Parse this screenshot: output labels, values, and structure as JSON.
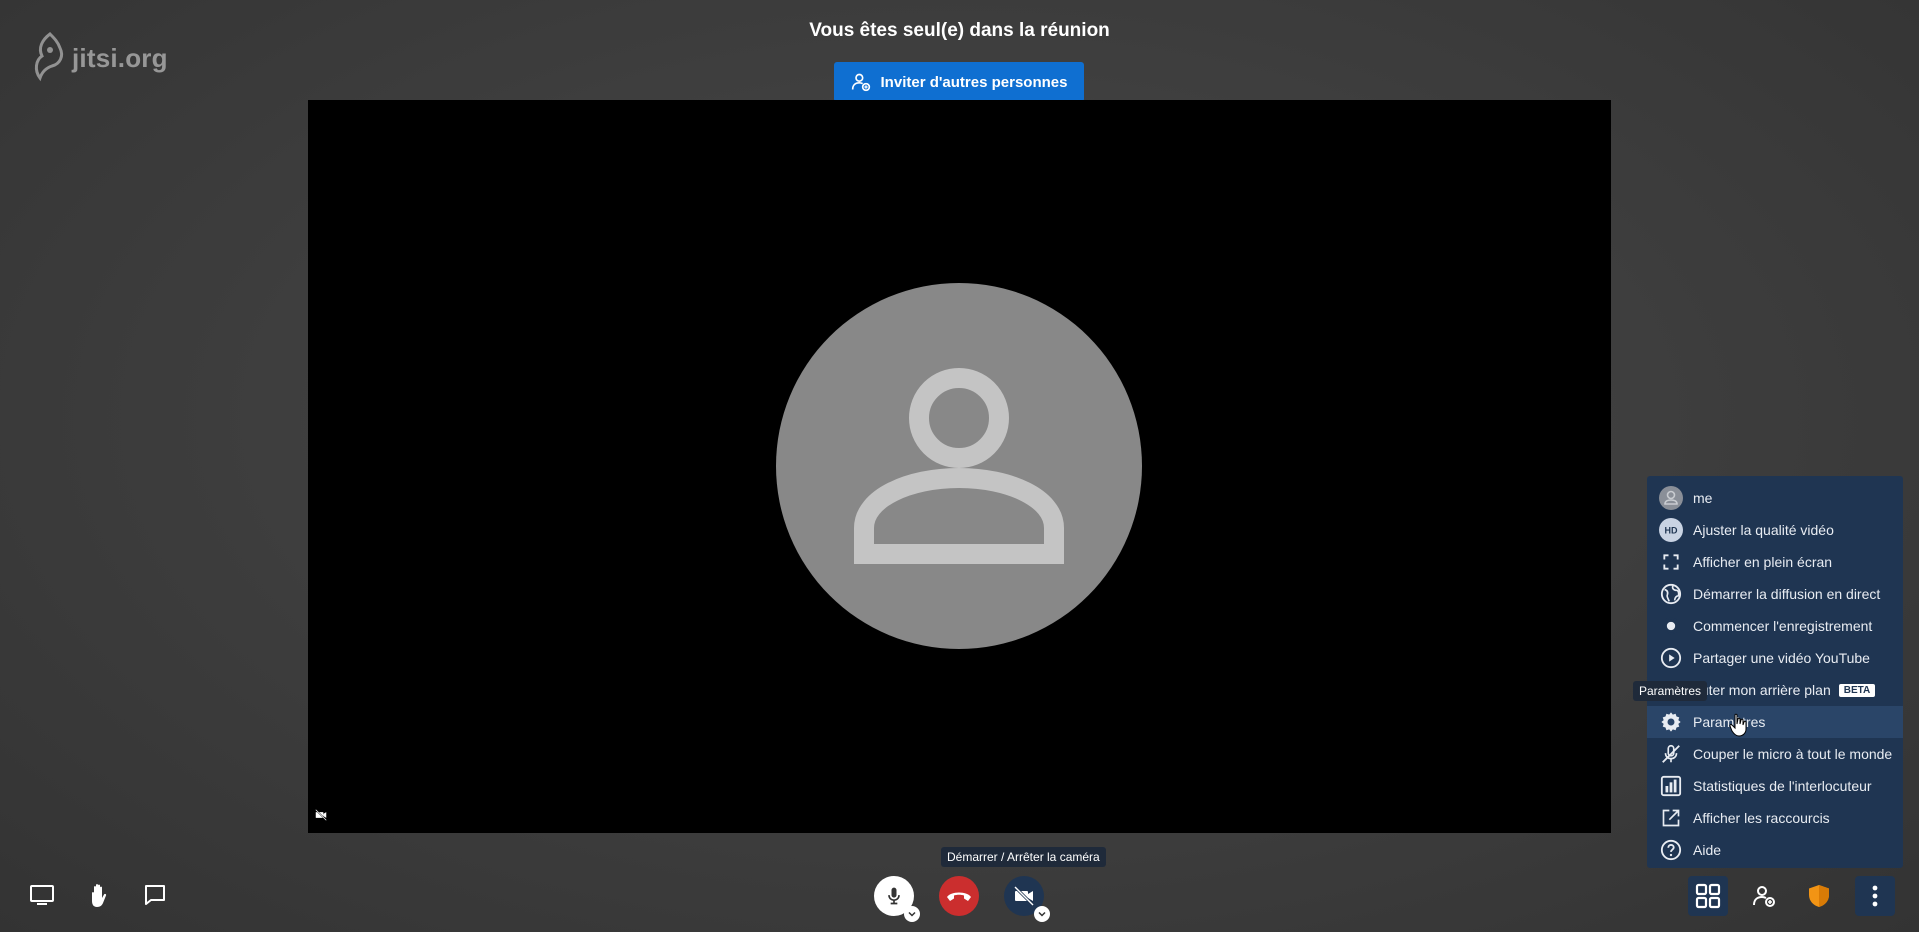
{
  "logo": {
    "text": "jitsi.org"
  },
  "header": {
    "title": "Vous êtes seul(e) dans la réunion"
  },
  "invite": {
    "label": "Inviter d'autres personnes"
  },
  "tooltips": {
    "camera": "Démarrer / Arrêter la caméra",
    "settings": "Paramètres"
  },
  "menu": {
    "items": [
      {
        "label": "me",
        "icon": "avatar-icon"
      },
      {
        "label": "Ajuster la qualité vidéo",
        "icon": "hd-icon"
      },
      {
        "label": "Afficher en plein écran",
        "icon": "fullscreen-icon"
      },
      {
        "label": "Démarrer la diffusion en direct",
        "icon": "globe-icon"
      },
      {
        "label": "Commencer l'enregistrement",
        "icon": "record-icon"
      },
      {
        "label": "Partager une vidéo YouTube",
        "icon": "play-icon"
      },
      {
        "label": "outer mon arrière plan",
        "icon": "background-icon",
        "badge": "BETA"
      },
      {
        "label": "Paramètres",
        "icon": "gear-icon"
      },
      {
        "label": "Couper le micro à tout le monde",
        "icon": "mic-off-icon"
      },
      {
        "label": "Statistiques de l'interlocuteur",
        "icon": "stats-icon"
      },
      {
        "label": "Afficher les raccourcis",
        "icon": "shortcut-icon"
      },
      {
        "label": "Aide",
        "icon": "help-icon"
      }
    ]
  },
  "colors": {
    "accent": "#0f6fd1",
    "hangup": "#cb2e2e",
    "menu_bg": "#1f3552"
  }
}
